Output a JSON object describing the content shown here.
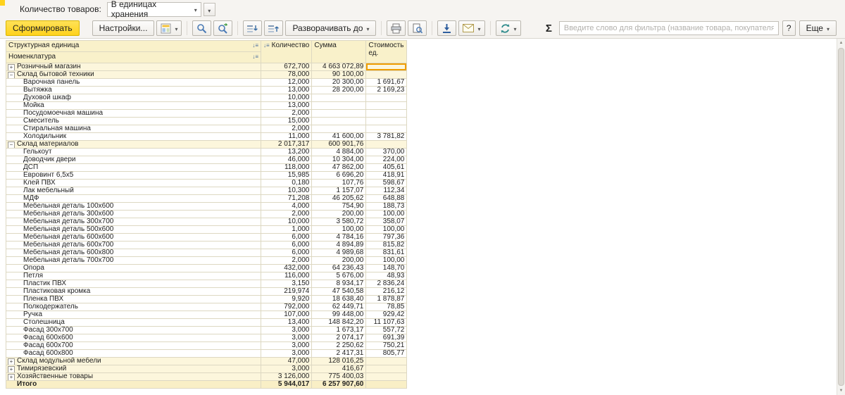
{
  "colors": {
    "accent_yellow": "#FFD21C",
    "table_header_bg": "#F9F1CA",
    "group_row_bg": "#FCF6DC",
    "total_row_bg": "#F9EFC6",
    "grid_line": "#DDD8C2",
    "selected_cell_border": "#EF9D00"
  },
  "param_bar": {
    "label": "Количество товаров:",
    "value": "В единицах хранения"
  },
  "toolbar": {
    "generate_label": "Сформировать",
    "settings_label": "Настройки...",
    "expand_to_label": "Разворачивать до",
    "sigma_label": "Σ",
    "filter_placeholder": "Введите слово для фильтра (название товара, покупателя и пр.)",
    "help_label": "?",
    "more_label": "Еще"
  },
  "table": {
    "headers": {
      "structural_unit": "Структурная единица",
      "nomenclature": "Номенклатура",
      "quantity": "Количество",
      "sum": "Сумма",
      "unit_cost": "Стоимость ед."
    },
    "selected_cell": {
      "row": 0,
      "col": "cost"
    },
    "rows": [
      {
        "type": "g",
        "exp": "+",
        "name": "Розничный магазин",
        "qty": "672,700",
        "sum": "4 663 072,89",
        "cost": ""
      },
      {
        "type": "g",
        "exp": "−",
        "name": "Склад бытовой техники",
        "qty": "78,000",
        "sum": "90 100,00",
        "cost": ""
      },
      {
        "type": "i",
        "name": "Варочная панель",
        "qty": "12,000",
        "sum": "20 300,00",
        "cost": "1 691,67"
      },
      {
        "type": "i",
        "name": "Вытяжка",
        "qty": "13,000",
        "sum": "28 200,00",
        "cost": "2 169,23"
      },
      {
        "type": "i",
        "name": "Духовой шкаф",
        "qty": "10,000",
        "sum": "",
        "cost": ""
      },
      {
        "type": "i",
        "name": "Мойка",
        "qty": "13,000",
        "sum": "",
        "cost": ""
      },
      {
        "type": "i",
        "name": "Посудомоечная машина",
        "qty": "2,000",
        "sum": "",
        "cost": ""
      },
      {
        "type": "i",
        "name": "Смеситель",
        "qty": "15,000",
        "sum": "",
        "cost": ""
      },
      {
        "type": "i",
        "name": "Стиральная машина",
        "qty": "2,000",
        "sum": "",
        "cost": ""
      },
      {
        "type": "i",
        "name": "Холодильник",
        "qty": "11,000",
        "sum": "41 600,00",
        "cost": "3 781,82"
      },
      {
        "type": "g",
        "exp": "−",
        "name": "Склад материалов",
        "qty": "2 017,317",
        "sum": "600 901,76",
        "cost": ""
      },
      {
        "type": "i",
        "name": "Гелькоут",
        "qty": "13,200",
        "sum": "4 884,00",
        "cost": "370,00"
      },
      {
        "type": "i",
        "name": "Доводчик двери",
        "qty": "46,000",
        "sum": "10 304,00",
        "cost": "224,00"
      },
      {
        "type": "i",
        "name": "ДСП",
        "qty": "118,000",
        "sum": "47 862,00",
        "cost": "405,61"
      },
      {
        "type": "i",
        "name": "Евровинт 6,5x5",
        "qty": "15,985",
        "sum": "6 696,20",
        "cost": "418,91"
      },
      {
        "type": "i",
        "name": "Клей ПВХ",
        "qty": "0,180",
        "sum": "107,76",
        "cost": "598,67"
      },
      {
        "type": "i",
        "name": "Лак мебельный",
        "qty": "10,300",
        "sum": "1 157,07",
        "cost": "112,34"
      },
      {
        "type": "i",
        "name": "МДФ",
        "qty": "71,208",
        "sum": "46 205,62",
        "cost": "648,88"
      },
      {
        "type": "i",
        "name": "Мебельная деталь 100x600",
        "qty": "4,000",
        "sum": "754,90",
        "cost": "188,73"
      },
      {
        "type": "i",
        "name": "Мебельная деталь 300x600",
        "qty": "2,000",
        "sum": "200,00",
        "cost": "100,00"
      },
      {
        "type": "i",
        "name": "Мебельная деталь 300x700",
        "qty": "10,000",
        "sum": "3 580,72",
        "cost": "358,07"
      },
      {
        "type": "i",
        "name": "Мебельная деталь 500x600",
        "qty": "1,000",
        "sum": "100,00",
        "cost": "100,00"
      },
      {
        "type": "i",
        "name": "Мебельная деталь 600x600",
        "qty": "6,000",
        "sum": "4 784,16",
        "cost": "797,36"
      },
      {
        "type": "i",
        "name": "Мебельная деталь 600x700",
        "qty": "6,000",
        "sum": "4 894,89",
        "cost": "815,82"
      },
      {
        "type": "i",
        "name": "Мебельная деталь 600x800",
        "qty": "6,000",
        "sum": "4 989,68",
        "cost": "831,61"
      },
      {
        "type": "i",
        "name": "Мебельная деталь 700x700",
        "qty": "2,000",
        "sum": "200,00",
        "cost": "100,00"
      },
      {
        "type": "i",
        "name": "Опора",
        "qty": "432,000",
        "sum": "64 236,43",
        "cost": "148,70"
      },
      {
        "type": "i",
        "name": "Петля",
        "qty": "116,000",
        "sum": "5 676,00",
        "cost": "48,93"
      },
      {
        "type": "i",
        "name": "Пластик ПВХ",
        "qty": "3,150",
        "sum": "8 934,17",
        "cost": "2 836,24"
      },
      {
        "type": "i",
        "name": "Пластиковая кромка",
        "qty": "219,974",
        "sum": "47 540,58",
        "cost": "216,12"
      },
      {
        "type": "i",
        "name": "Пленка ПВХ",
        "qty": "9,920",
        "sum": "18 638,40",
        "cost": "1 878,87"
      },
      {
        "type": "i",
        "name": "Полкодержатель",
        "qty": "792,000",
        "sum": "62 449,71",
        "cost": "78,85"
      },
      {
        "type": "i",
        "name": "Ручка",
        "qty": "107,000",
        "sum": "99 448,00",
        "cost": "929,42"
      },
      {
        "type": "i",
        "name": "Столешница",
        "qty": "13,400",
        "sum": "148 842,20",
        "cost": "11 107,63"
      },
      {
        "type": "i",
        "name": "Фасад 300x700",
        "qty": "3,000",
        "sum": "1 673,17",
        "cost": "557,72"
      },
      {
        "type": "i",
        "name": "Фасад 600x600",
        "qty": "3,000",
        "sum": "2 074,17",
        "cost": "691,39"
      },
      {
        "type": "i",
        "name": "Фасад 600x700",
        "qty": "3,000",
        "sum": "2 250,62",
        "cost": "750,21"
      },
      {
        "type": "i",
        "name": "Фасад 600x800",
        "qty": "3,000",
        "sum": "2 417,31",
        "cost": "805,77"
      },
      {
        "type": "g",
        "exp": "+",
        "name": "Склад модульной мебели",
        "qty": "47,000",
        "sum": "128 016,25",
        "cost": ""
      },
      {
        "type": "g",
        "exp": "+",
        "name": "Тимирязевский",
        "qty": "3,000",
        "sum": "416,67",
        "cost": ""
      },
      {
        "type": "g",
        "exp": "+",
        "name": "Хозяйственные товары",
        "qty": "3 126,000",
        "sum": "775 400,03",
        "cost": ""
      },
      {
        "type": "t",
        "name": "Итого",
        "qty": "5 944,017",
        "sum": "6 257 907,60",
        "cost": ""
      }
    ]
  }
}
